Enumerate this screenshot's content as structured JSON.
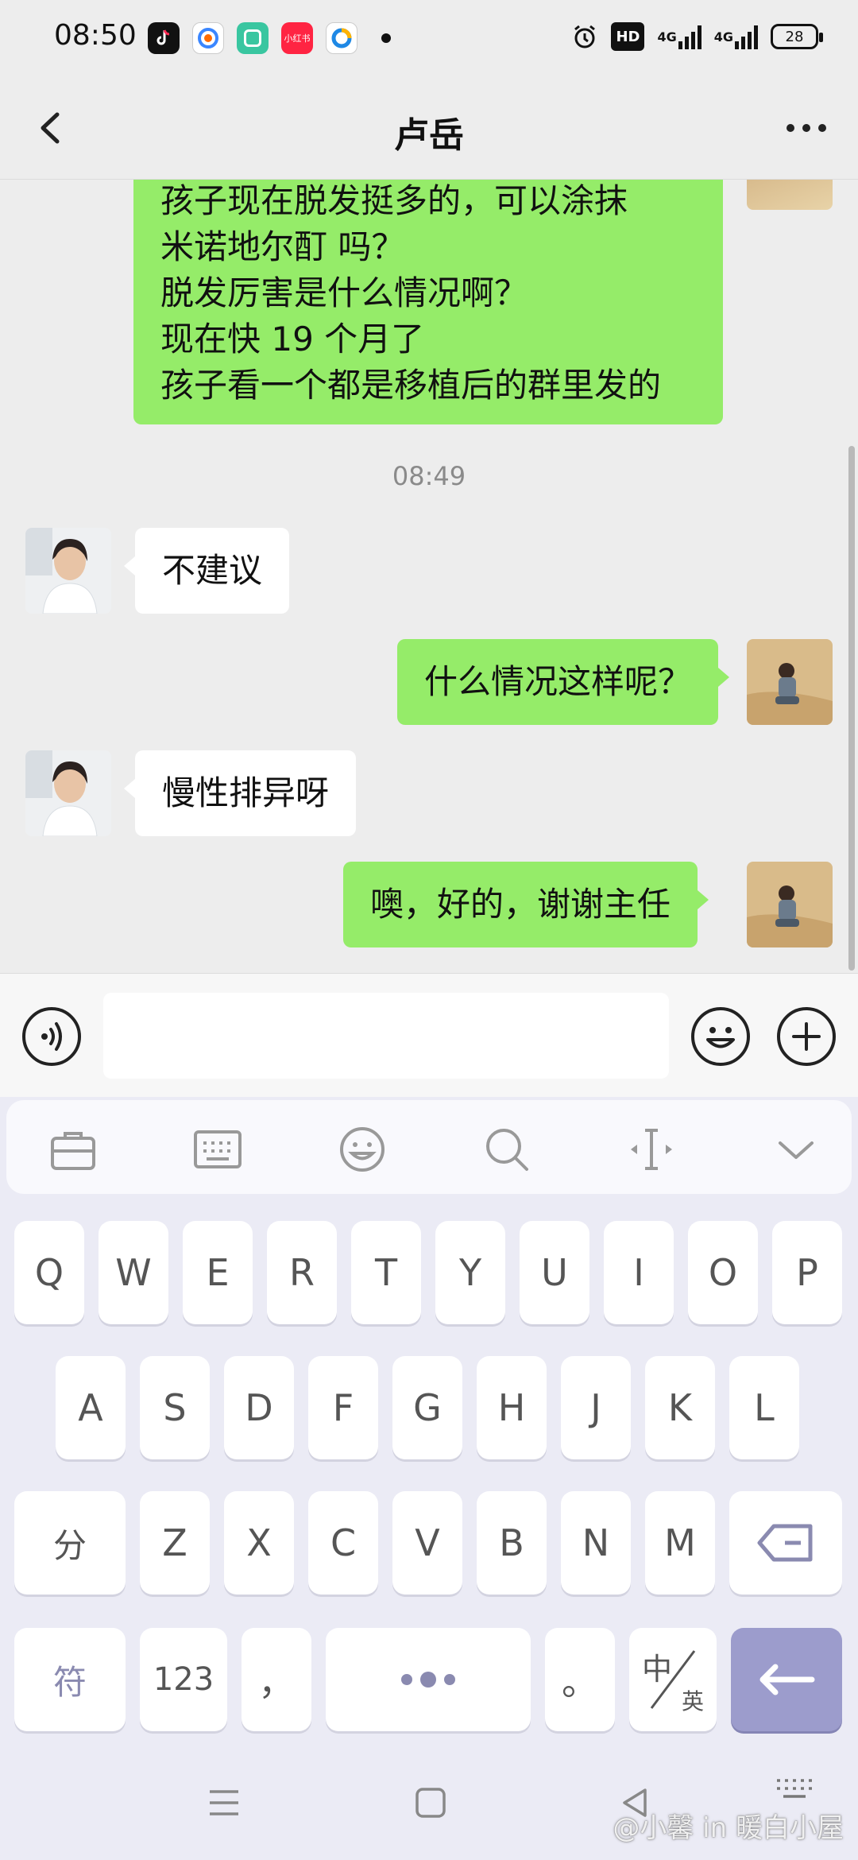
{
  "status_bar": {
    "time": "08:50",
    "app_icons": [
      "tiktok-icon",
      "browser-icon",
      "app-green-icon",
      "xiaohongshu-icon",
      "qq-browser-icon"
    ],
    "xiaohongshu_label": "小红书",
    "hd_label": "HD",
    "net1": "4G",
    "net2": "4G",
    "battery": "28"
  },
  "header": {
    "title": "卢岳"
  },
  "messages": [
    {
      "side": "sent",
      "lines": [
        "孩子现在脱发挺多的，可以涂抹",
        "米诺地尔酊  吗？",
        "脱发厉害是什么情况啊？",
        "现在快 19 个月了",
        "孩子看一个都是移植后的群里发的"
      ]
    },
    {
      "timestamp": "08:49"
    },
    {
      "side": "recv",
      "text": "不建议"
    },
    {
      "side": "sent",
      "text": "什么情况这样呢？"
    },
    {
      "side": "recv",
      "text": "慢性排异呀"
    },
    {
      "side": "sent",
      "text": "噢，好的，谢谢主任"
    }
  ],
  "input": {
    "placeholder": ""
  },
  "keyboard": {
    "row1": [
      "Q",
      "W",
      "E",
      "R",
      "T",
      "Y",
      "U",
      "I",
      "O",
      "P"
    ],
    "row2": [
      "A",
      "S",
      "D",
      "F",
      "G",
      "H",
      "J",
      "K",
      "L"
    ],
    "row3": [
      "分",
      "Z",
      "X",
      "C",
      "V",
      "B",
      "N",
      "M"
    ],
    "row4": {
      "symbol": "符",
      "num": "123",
      "comma": "，",
      "period": "。",
      "lang_top": "中",
      "lang_bottom": "英"
    }
  },
  "watermark": "@小馨 in 暖白小屋",
  "colors": {
    "sent_bubble": "#95ec69",
    "recv_bubble": "#ffffff",
    "background": "#ededed",
    "enter_key": "#9c9ccc"
  }
}
